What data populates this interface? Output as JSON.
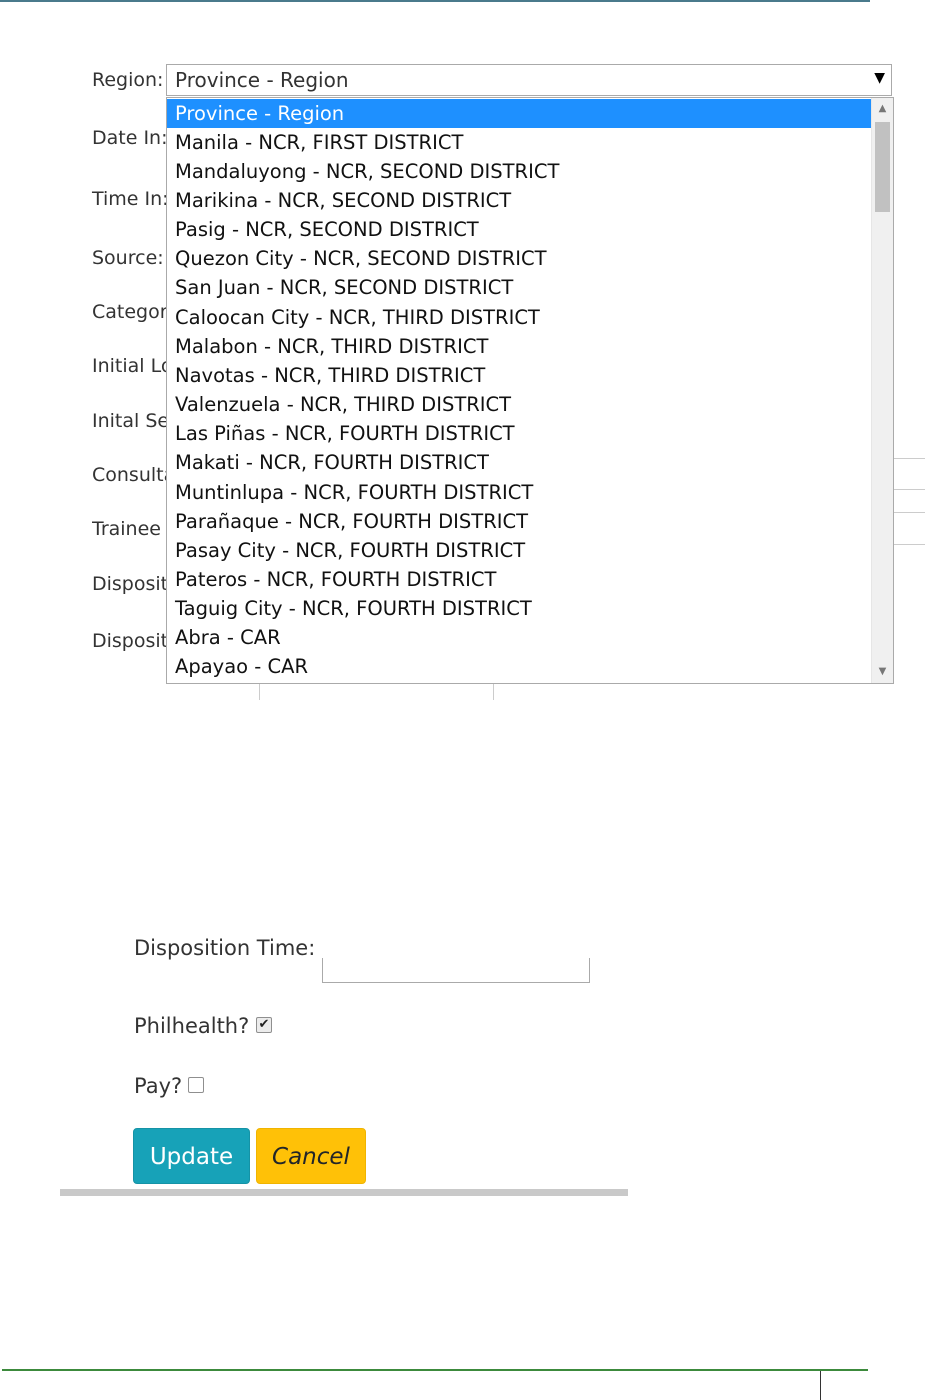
{
  "form": {
    "labels": {
      "region": "Region:",
      "date_in": "Date In:",
      "time_in": "Time In:",
      "source": "Source:",
      "category": "Categor",
      "initial_lo": "Initial Lo",
      "initial_se": "Inital Se",
      "consulta": "Consulta",
      "trainee": "Trainee i",
      "disposit_1": "Disposit",
      "disposit_2": "Disposit"
    },
    "region_select": {
      "value": "Province - Region",
      "options": [
        "Province - Region",
        "Manila - NCR, FIRST DISTRICT",
        "Mandaluyong - NCR, SECOND DISTRICT",
        "Marikina - NCR, SECOND DISTRICT",
        "Pasig - NCR, SECOND DISTRICT",
        "Quezon City - NCR, SECOND DISTRICT",
        "San Juan - NCR, SECOND DISTRICT",
        "Caloocan City - NCR, THIRD DISTRICT",
        "Malabon - NCR, THIRD DISTRICT",
        "Navotas - NCR, THIRD DISTRICT",
        "Valenzuela - NCR, THIRD DISTRICT",
        "Las Piñas - NCR, FOURTH DISTRICT",
        "Makati - NCR, FOURTH DISTRICT",
        "Muntinlupa - NCR, FOURTH DISTRICT",
        "Parañaque - NCR, FOURTH DISTRICT",
        "Pasay City - NCR, FOURTH DISTRICT",
        "Pateros - NCR, FOURTH DISTRICT",
        "Taguig City - NCR, FOURTH DISTRICT",
        "Abra - CAR",
        "Apayao - CAR"
      ],
      "selected_index": 0,
      "arrow_icon": "triangle-down-icon"
    }
  },
  "bottom_form": {
    "disposition_time_label": "Disposition Time:",
    "philhealth_label": "Philhealth?",
    "philhealth_checked": true,
    "pay_label": "Pay?",
    "pay_checked": false,
    "update_label": "Update",
    "cancel_label": "Cancel"
  },
  "colors": {
    "update": "#17a2b8",
    "cancel": "#ffc107",
    "selected_option": "#1e90ff"
  }
}
